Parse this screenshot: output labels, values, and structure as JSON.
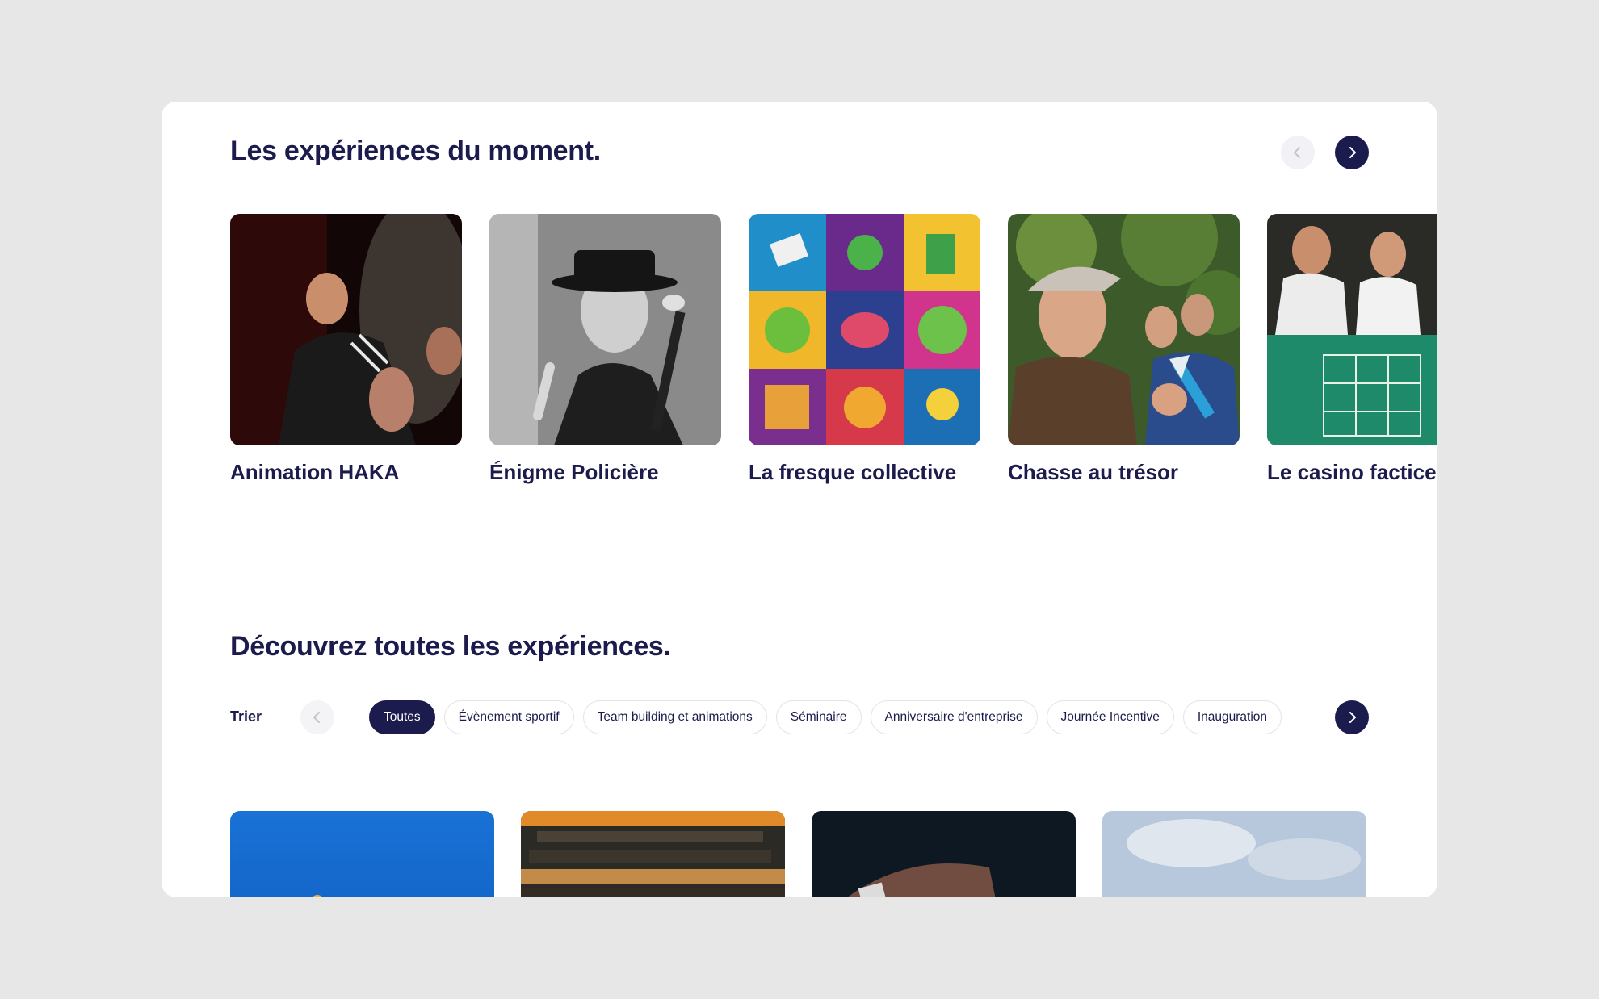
{
  "featured": {
    "title": "Les expériences du moment.",
    "cards": [
      {
        "title": "Animation HAKA"
      },
      {
        "title": "Énigme Policière"
      },
      {
        "title": "La fresque collective"
      },
      {
        "title": "Chasse au trésor"
      },
      {
        "title": "Le casino factice"
      }
    ]
  },
  "all": {
    "title": "Découvrez toutes les expériences.",
    "sort_label": "Trier",
    "filters": [
      {
        "label": "Toutes",
        "active": true
      },
      {
        "label": "Évènement sportif",
        "active": false
      },
      {
        "label": "Team building et animations",
        "active": false
      },
      {
        "label": "Séminaire",
        "active": false
      },
      {
        "label": "Anniversaire d'entreprise",
        "active": false
      },
      {
        "label": "Journée Incentive",
        "active": false
      },
      {
        "label": "Inauguration",
        "active": false
      }
    ]
  },
  "colors": {
    "accent": "#1b1b4d",
    "page_bg": "#e7e7e8",
    "panel_bg": "#ffffff"
  },
  "icons": {
    "prev": "chevron-left-icon",
    "next": "chevron-right-icon"
  }
}
